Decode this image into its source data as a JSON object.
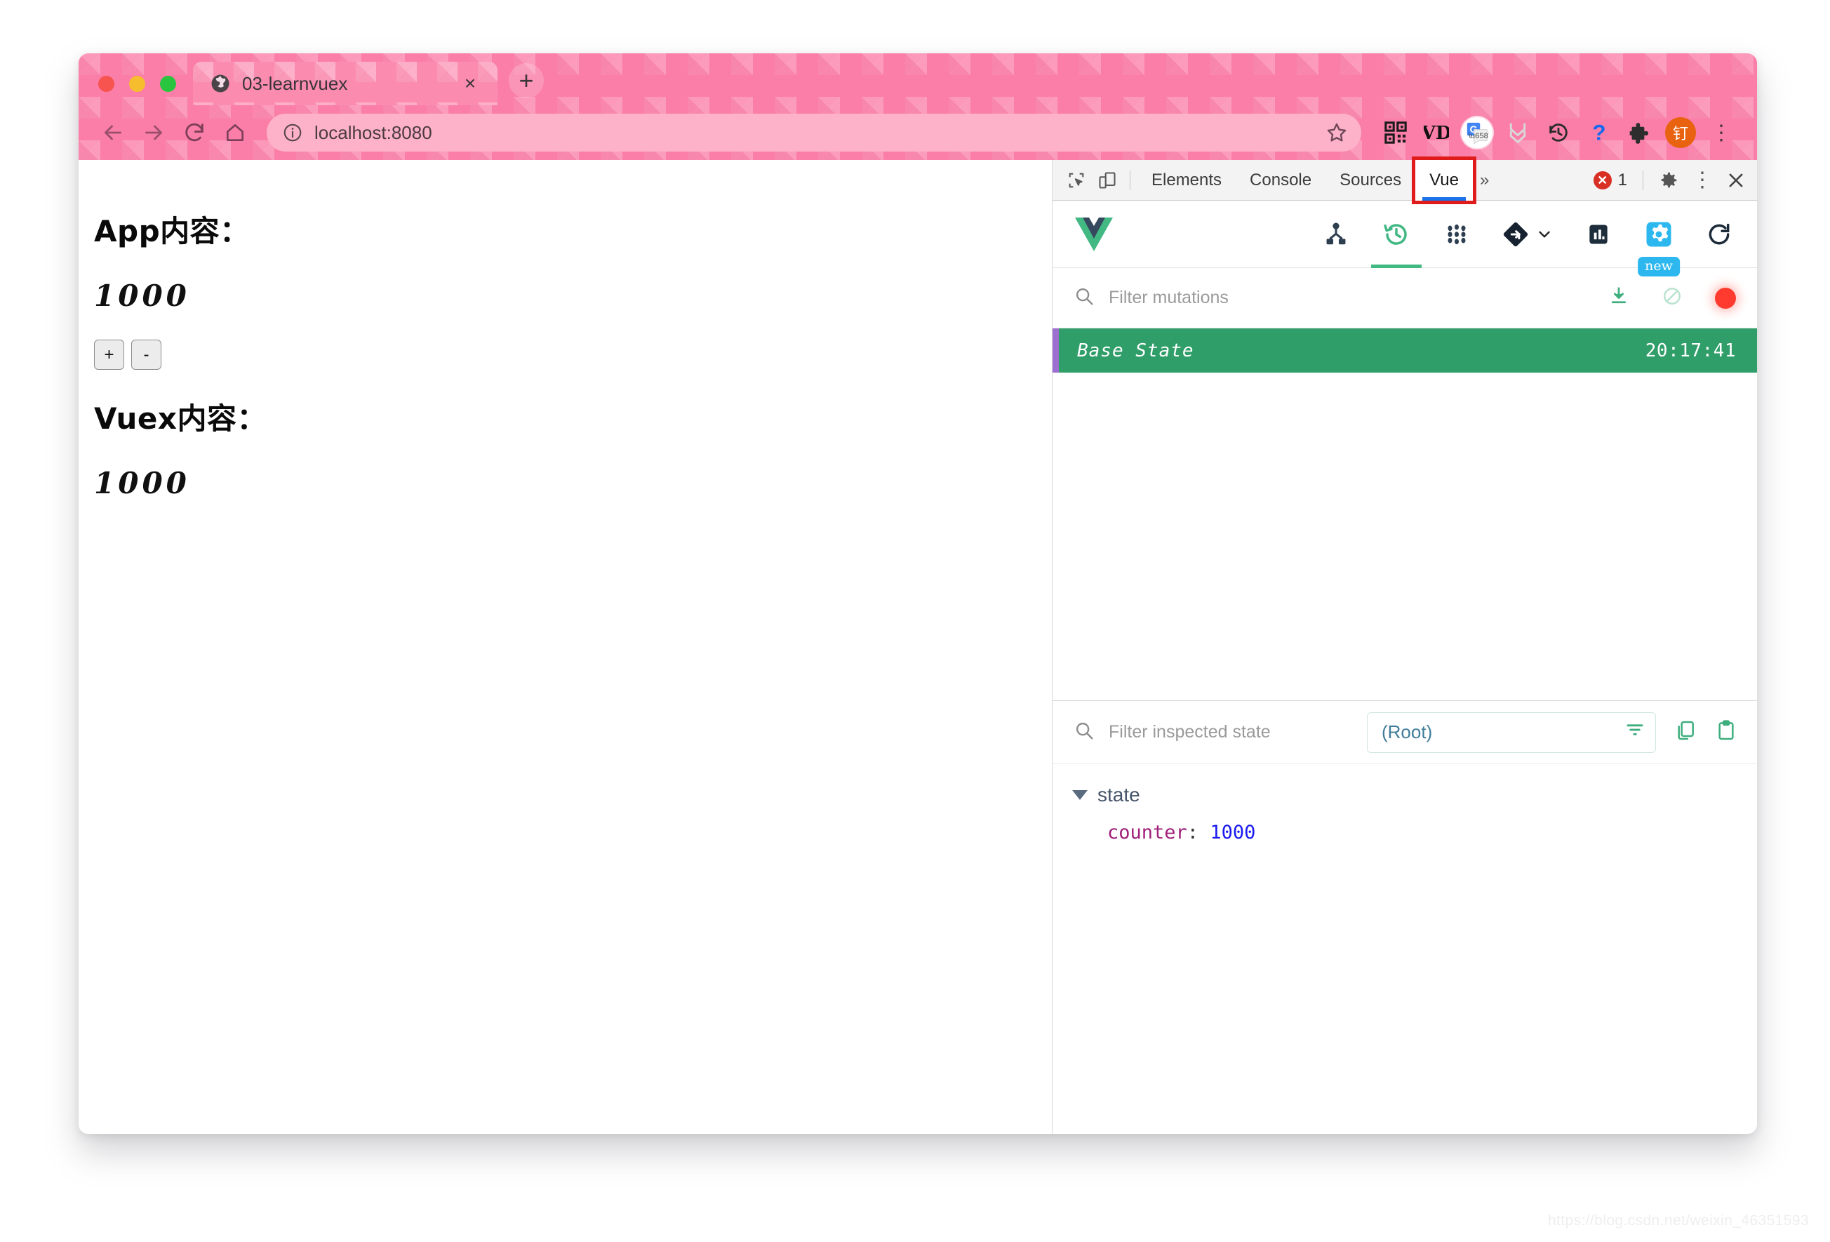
{
  "window": {
    "traffic_lights": [
      "close",
      "minimize",
      "maximize"
    ]
  },
  "browser": {
    "tab": {
      "title": "03-learnvuex",
      "favicon": "globe-icon",
      "close_label": "×"
    },
    "new_tab_label": "+",
    "nav": {
      "back": "back-arrow-icon",
      "forward": "forward-arrow-icon",
      "reload": "reload-icon",
      "home": "home-icon"
    },
    "omnibox": {
      "url": "localhost:8080",
      "info_icon": "info-circle-icon",
      "star_icon": "bookmark-star-icon"
    },
    "extensions": [
      {
        "name": "qr-code-icon",
        "glyph": "█"
      },
      {
        "name": "vd-downloader-icon",
        "glyph": "VD"
      },
      {
        "name": "google-translate-icon",
        "glyph": "G"
      },
      {
        "name": "chevron-double-down-icon",
        "glyph": "⌄"
      },
      {
        "name": "history-clock-icon",
        "glyph": "↺"
      },
      {
        "name": "help-question-icon",
        "glyph": "?"
      },
      {
        "name": "puzzle-extensions-icon",
        "glyph": "❖"
      },
      {
        "name": "dingtalk-icon",
        "glyph": "钉"
      }
    ],
    "menu_label": "⋮"
  },
  "page": {
    "app_heading": "App内容：",
    "app_counter": "1000",
    "increment_label": "+",
    "decrement_label": "-",
    "vuex_heading": "Vuex内容：",
    "vuex_counter": "1000"
  },
  "devtools": {
    "inspect_icon": "inspect-element-icon",
    "device_icon": "device-toolbar-icon",
    "tabs": [
      {
        "label": "Elements",
        "active": false
      },
      {
        "label": "Console",
        "active": false
      },
      {
        "label": "Sources",
        "active": false
      },
      {
        "label": "Vue",
        "active": true
      }
    ],
    "overflow_label": "»",
    "error_count": "1",
    "error_icon": "error-circle-icon",
    "settings_icon": "gear-icon",
    "kebab_icon": "kebab-menu-icon",
    "close_icon": "close-icon",
    "highlight_color": "#e01b1b",
    "active_tab_underline": "#1a73e8"
  },
  "vue_devtools": {
    "logo": "vue-logo-icon",
    "toolbar_buttons": [
      {
        "name": "components-tree-icon",
        "active": false
      },
      {
        "name": "vuex-timetravel-icon",
        "active": true
      },
      {
        "name": "events-dots-icon",
        "active": false
      },
      {
        "name": "routing-icon",
        "active": false
      },
      {
        "name": "performance-chart-icon",
        "active": false
      },
      {
        "name": "settings-gear-icon",
        "active": false,
        "badge": "new"
      },
      {
        "name": "refresh-icon",
        "active": false
      }
    ],
    "mutations": {
      "filter_placeholder": "Filter mutations",
      "search_icon": "search-icon",
      "export_icon": "download-export-icon",
      "clear_icon": "clear-ban-icon",
      "record_icon": "record-dot-icon",
      "rows": [
        {
          "name": "Base State",
          "time": "20:17:41",
          "selected": true
        }
      ],
      "selected_color": "#2f9e68",
      "marker_color": "#9d6fd0"
    },
    "inspector": {
      "filter_placeholder": "Filter inspected state",
      "search_icon": "search-icon",
      "scope_value": "(Root)",
      "scope_filter_icon": "filter-lines-icon",
      "copy_icon": "copy-icon",
      "paste_icon": "clipboard-paste-icon",
      "tree": {
        "root_label": "state",
        "entries": [
          {
            "key": "counter",
            "value": "1000"
          }
        ]
      }
    }
  },
  "watermark": "https://blog.csdn.net/weixin_46351593"
}
